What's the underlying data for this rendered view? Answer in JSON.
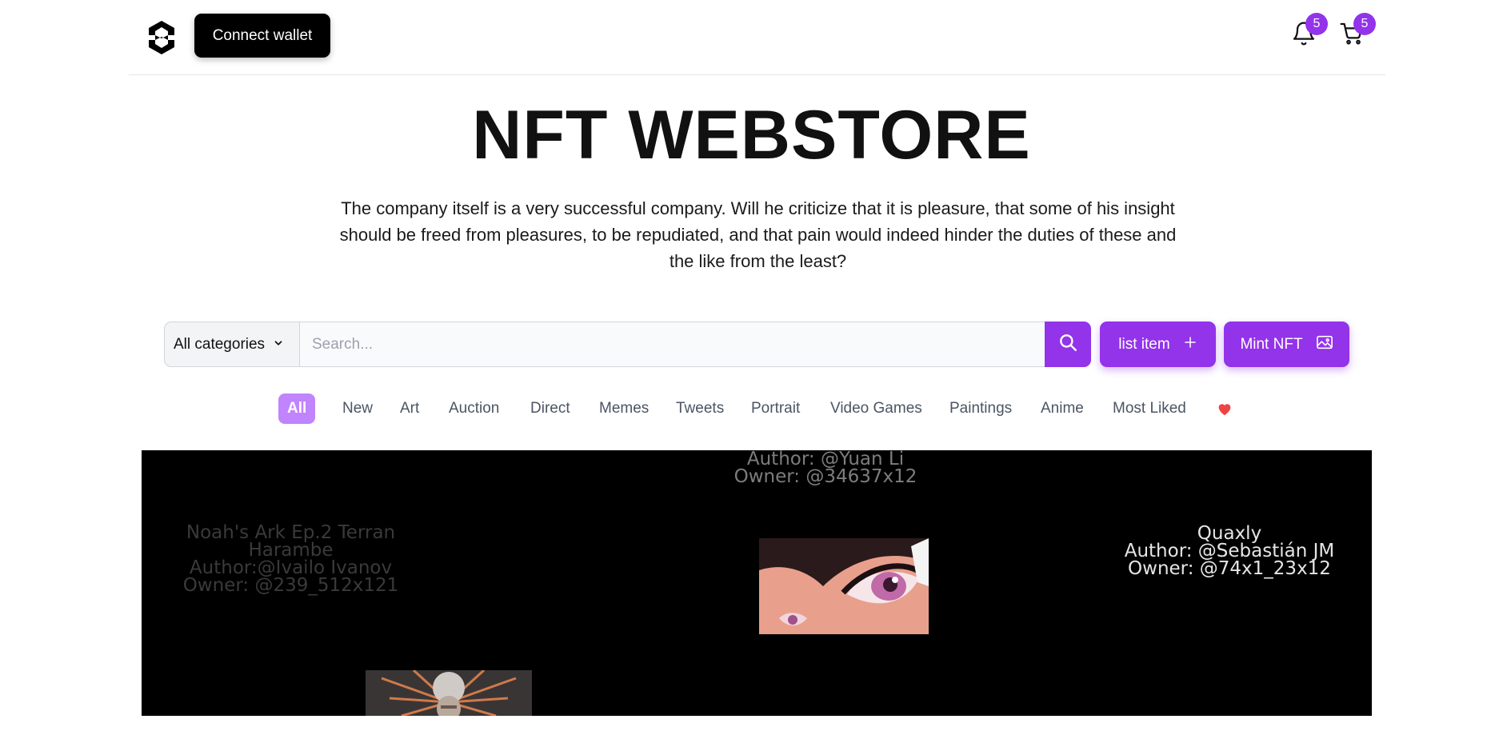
{
  "header": {
    "connect_label": "Connect wallet",
    "notifications_count": "5",
    "cart_count": "5"
  },
  "hero": {
    "title": "NFT WEBSTORE",
    "description": "The company itself is a very successful company. Will he criticize that it is pleasure, that some of his insight should be freed from pleasures, to be repudiated, and that pain would indeed hinder the duties of these and the like from the least?"
  },
  "search": {
    "category_label": "All categories",
    "placeholder": "Search...",
    "list_item_label": "list item",
    "mint_label": "Mint NFT"
  },
  "filters": [
    "All",
    "New",
    "Art",
    "Auction",
    "Direct",
    "Memes",
    "Tweets",
    "Portrait",
    "Video Games",
    "Paintings",
    "Anime",
    "Most Liked"
  ],
  "showcase": {
    "items": [
      {
        "title": "Noah's Ark Ep.2 Terran Harambe",
        "author": "Author:@Ivailo Ivanov",
        "owner": "Owner: @239_512x121"
      },
      {
        "author": "Author: @Yuan Li",
        "owner": "Owner: @34637x12"
      },
      {
        "title": "Quaxly",
        "author": "Author: @Sebastián JM",
        "owner": "Owner: @74x1_23x12"
      }
    ]
  },
  "colors": {
    "accent": "#9333ea",
    "chip_active": "#c084fc",
    "heart": "#ef4444"
  },
  "icons": [
    "logo-icon",
    "bell-icon",
    "cart-icon",
    "chevron-down-icon",
    "search-icon",
    "plus-icon",
    "image-icon",
    "heart-icon"
  ]
}
